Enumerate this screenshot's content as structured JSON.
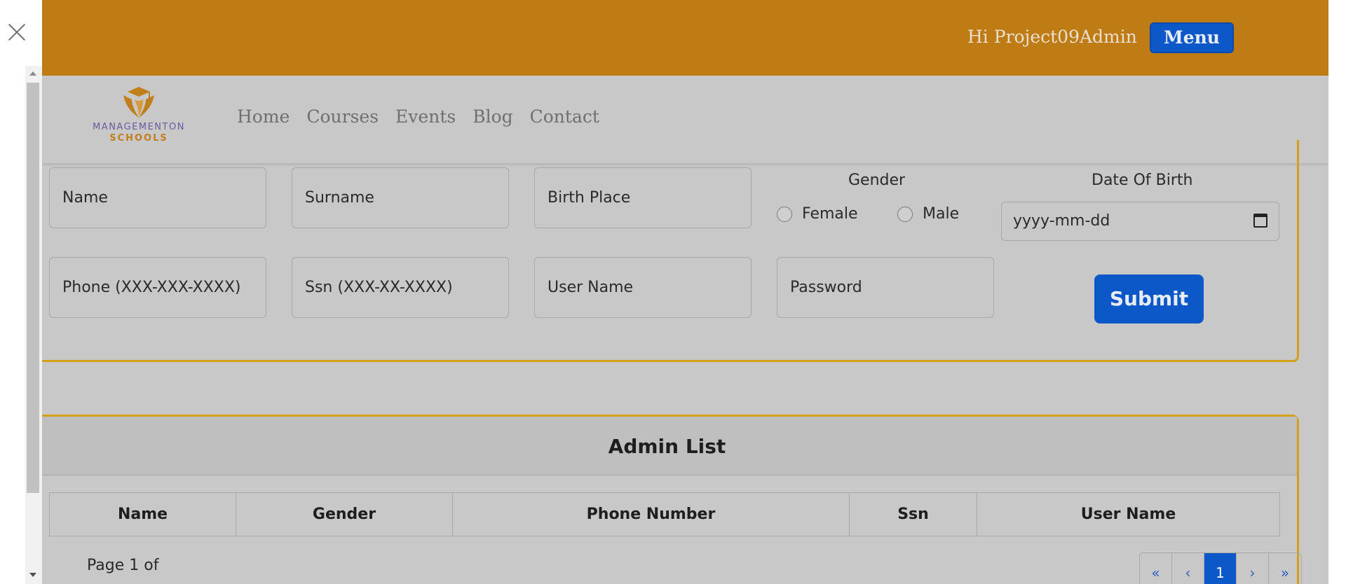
{
  "topbar": {
    "greeting": "Hi Project09Admin",
    "menu_label": "Menu"
  },
  "logo": {
    "line1": "MANAGEMENTON",
    "line2": "SCHOOLS"
  },
  "nav": [
    "Home",
    "Courses",
    "Events",
    "Blog",
    "Contact"
  ],
  "form": {
    "name": "Name",
    "surname": "Surname",
    "birth_place": "Birth Place",
    "gender_title": "Gender",
    "female": "Female",
    "male": "Male",
    "dob_title": "Date Of Birth",
    "dob_placeholder": "yyyy-mm-dd",
    "phone": "Phone (XXX-XXX-XXXX)",
    "ssn": "Ssn (XXX-XX-XXXX)",
    "username": "User Name",
    "password": "Password",
    "submit": "Submit"
  },
  "admin_list": {
    "title": "Admin List",
    "columns": [
      "Name",
      "Gender",
      "Phone Number",
      "Ssn",
      "User Name"
    ],
    "page_info": "Page 1 of",
    "pager": [
      "«",
      "‹",
      "1",
      "›",
      "»"
    ]
  },
  "colors": {
    "topbar": "#bf7b14",
    "primary": "#0d58c8",
    "card_border": "#d4a01a"
  }
}
